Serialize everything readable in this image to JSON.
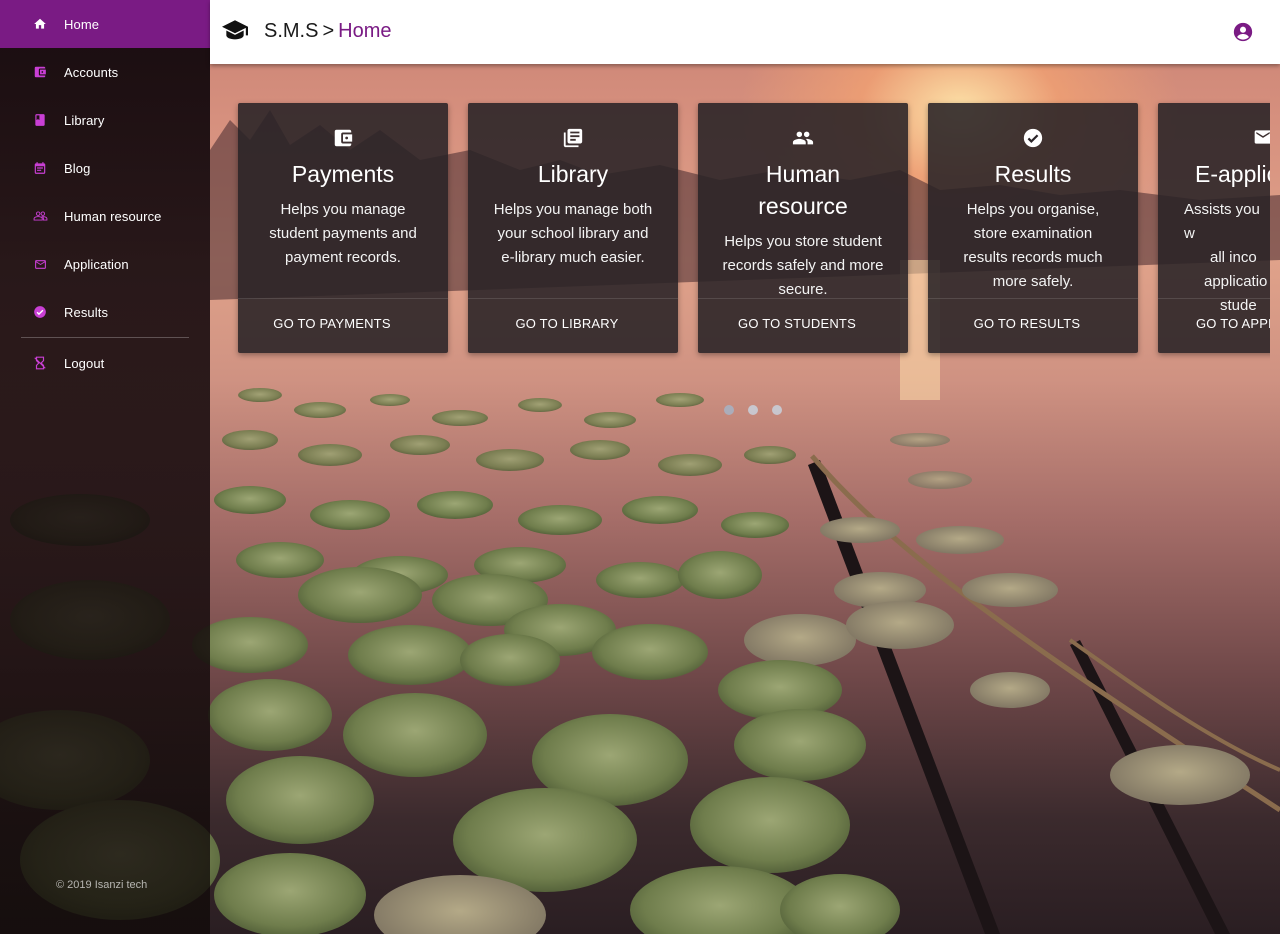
{
  "app": {
    "brand": "S.M.S",
    "separator": ">",
    "breadcrumb": "Home"
  },
  "sidebar": {
    "items": [
      {
        "label": "Home",
        "icon": "home-icon",
        "active": true
      },
      {
        "label": "Accounts",
        "icon": "wallet-icon"
      },
      {
        "label": "Library",
        "icon": "book-icon"
      },
      {
        "label": "Blog",
        "icon": "calendar-note-icon"
      },
      {
        "label": "Human resource",
        "icon": "people-icon"
      },
      {
        "label": "Application",
        "icon": "mail-icon"
      },
      {
        "label": "Results",
        "icon": "check-circle-icon"
      },
      {
        "label": "Logout",
        "icon": "logout-icon"
      }
    ],
    "copyright": "© 2019 Isanzi tech"
  },
  "cards": [
    {
      "title": "Payments",
      "description": "Helps you manage student payments and payment records.",
      "link": "GO TO PAYMENTS",
      "icon": "wallet-icon"
    },
    {
      "title": "Library",
      "description": "Helps you manage both your school library and e-library much easier.",
      "link": "GO TO LIBRARY",
      "icon": "library-icon"
    },
    {
      "title": "Human resource",
      "description": "Helps you store student records safely and more secure.",
      "link": "GO TO STUDENTS",
      "icon": "people-icon"
    },
    {
      "title": "Results",
      "description": "Helps you organise, store examination results records much more safely.",
      "link": "GO TO RESULTS",
      "icon": "check-circle-icon"
    },
    {
      "title": "E-applic",
      "description": "Assists you w all inco applicatio stude",
      "link": "GO TO APPL",
      "icon": "mail-icon"
    }
  ],
  "carousel": {
    "pages": 3,
    "active": 0
  },
  "colors": {
    "accent": "#7a1b84",
    "card_bg": "#2a2428",
    "topbar_bg": "#ffffff"
  }
}
